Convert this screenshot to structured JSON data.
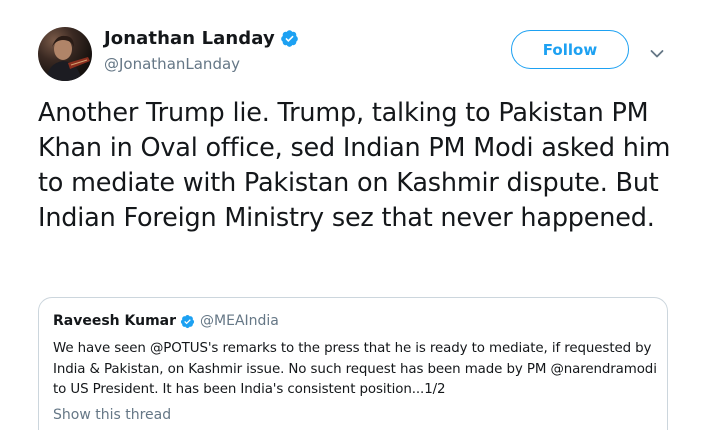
{
  "author": {
    "display_name": "Jonathan Landay",
    "handle": "@JonathanLanday",
    "verified": true
  },
  "follow_button": {
    "label": "Follow"
  },
  "tweet": {
    "text": "Another Trump lie. Trump, talking to Pakistan PM Khan in Oval office, sed Indian PM Modi asked him to mediate with Pakistan on Kashmir dispute. But Indian Foreign Ministry sez that never happened."
  },
  "quoted_tweet": {
    "display_name": "Raveesh Kumar",
    "handle": "@MEAIndia",
    "verified": true,
    "text": "We have seen @POTUS's remarks to the press that he is ready to mediate, if requested by India & Pakistan, on Kashmir issue. No such request has been made by PM @narendramodi to US President. It has been India's consistent position...1/2",
    "show_thread_label": "Show this thread"
  },
  "icons": {
    "verified": "verified-badge-icon",
    "caret": "chevron-down-icon"
  },
  "colors": {
    "accent": "#1da1f2",
    "secondary_text": "#657786",
    "border": "#ccd6dd",
    "text": "#14171a"
  }
}
